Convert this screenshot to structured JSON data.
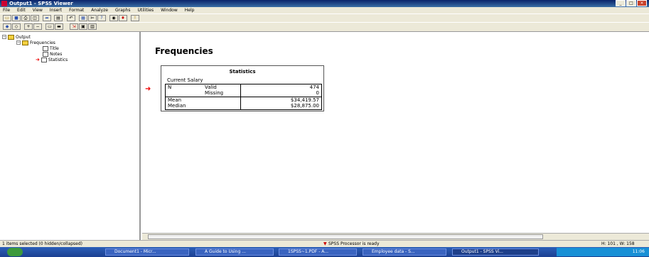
{
  "window": {
    "title": "Output1 - SPSS Viewer",
    "buttons": [
      "_",
      "□",
      "×"
    ]
  },
  "menu": [
    "File",
    "Edit",
    "View",
    "Insert",
    "Format",
    "Analyze",
    "Graphs",
    "Utilities",
    "Window",
    "Help"
  ],
  "tree": {
    "root": "Output",
    "frequencies": "Frequencies",
    "children": [
      "Title",
      "Notes",
      "Statistics"
    ]
  },
  "output": {
    "heading": "Frequencies",
    "stats_title": "Statistics",
    "variable": "Current Salary",
    "rows": [
      {
        "label": "N",
        "sub": "Valid",
        "value": "474"
      },
      {
        "label": "",
        "sub": "Missing",
        "value": "0"
      },
      {
        "label": "Mean",
        "sub": "",
        "value": "$34,419.57"
      },
      {
        "label": "Median",
        "sub": "",
        "value": "$28,875.00"
      }
    ]
  },
  "status": {
    "left": "1 items selected (0 hidden/collapsed)",
    "center": "SPSS Processor  is ready",
    "right": "H: 101 , W: 158"
  },
  "taskbar": {
    "tasks": [
      "Document1 - Micr...",
      "A Guide to Using ...",
      "1SPSS~1.PDF - A...",
      "Employee data - S...",
      "Output1 - SPSS Vi..."
    ],
    "clock": "11:06"
  }
}
